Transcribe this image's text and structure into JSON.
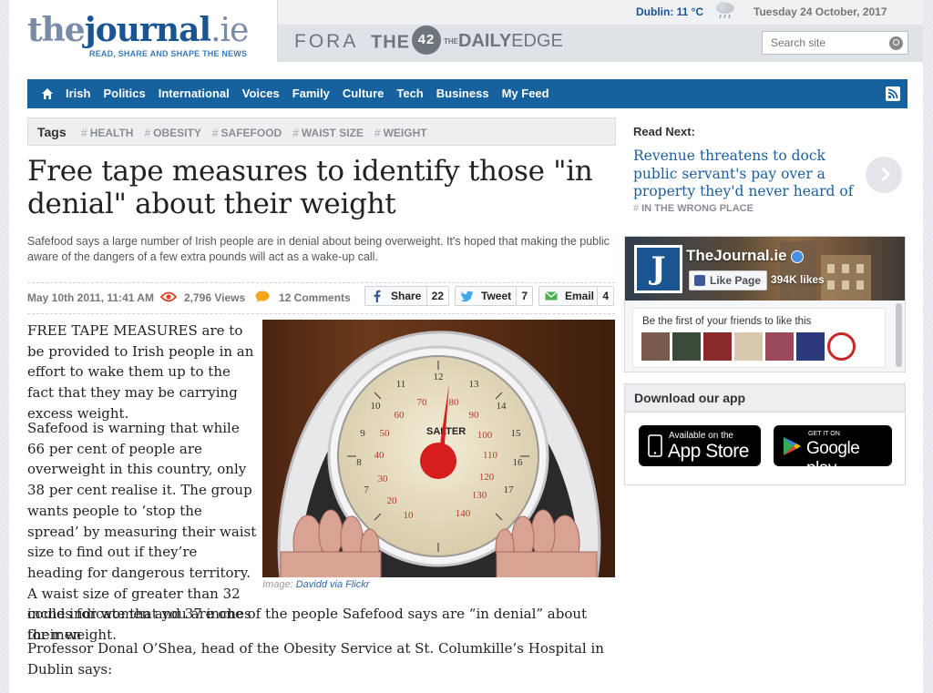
{
  "header": {
    "logo": {
      "the": "the",
      "journal": "journal",
      "ie": ".ie"
    },
    "tagline": "READ, SHARE AND SHAPE THE NEWS",
    "weather": "Dublin: 11 °C",
    "weather_icon": "rain-cloud-icon",
    "date": "Tuesday 24 October, 2017",
    "sister_sites": {
      "fora": "FORA",
      "the42_prefix": "THE",
      "the42_num": "42",
      "daily": "DAILY",
      "edge": "EDGE",
      "dailyedge_prefix": "THE"
    },
    "search_placeholder": "Search site"
  },
  "nav": {
    "items": [
      "Irish",
      "Politics",
      "International",
      "Voices",
      "Family",
      "Culture",
      "Tech",
      "Business",
      "My Feed"
    ]
  },
  "tags": {
    "label": "Tags",
    "items": [
      "HEALTH",
      "OBESITY",
      "SAFEFOOD",
      "WAIST SIZE",
      "WEIGHT"
    ]
  },
  "article": {
    "title": "Free tape measures to identify those \"in denial\" about their weight",
    "standfirst": "Safefood says a large number of Irish people are in denial about being overweight. It's hoped that making the public aware of the dangers of a few extra pounds will act as a wake-up call.",
    "meta": {
      "date": "May 10th 2011, 11:41 AM",
      "views": "2,796 Views",
      "comments": "12 Comments"
    },
    "share": {
      "facebook_label": "Share",
      "facebook_count": "22",
      "tweet_label": "Tweet",
      "tweet_count": "7",
      "email_label": "Email",
      "email_count": "4"
    },
    "p1": "FREE TAPE MEASURES are to be provided to Irish people in an effort to wake them up to the fact that they may be carrying excess weight.",
    "p2_col": "Safefood is warning that while 66 per cent of people are overweight in this country, only 38 per cent realise it. The group wants people to ‘stop the spread’ by measuring their waist size to find out if they’re heading for dangerous territory. A waist size of greater than 32 inches for women and 37 inches for men",
    "p2_full": "could indicate that you are one of the people Safefood says are “in denial” about their weight.",
    "p3": "Professor Donal O’Shea, head of the Obesity Service at St. Columkille’s Hospital in Dublin says:",
    "image_caption_prefix": "Image:",
    "image_credit": "Davidd via Flickr",
    "scale_brand": "SALTER"
  },
  "sidebar": {
    "read_next_label": "Read Next:",
    "read_next_title": "Revenue threatens to dock public servant's pay over a property they'd never heard of",
    "read_next_tag": "IN THE WRONG PLACE",
    "facebook": {
      "page_name": "TheJournal.ie",
      "logo_letter": "J",
      "like_label": "Like Page",
      "likes": "394K likes",
      "friends_text": "Be the first of your friends to like this"
    },
    "app": {
      "heading": "Download our app",
      "apple_small": "Available on the",
      "apple_big": "App Store",
      "google_small": "GET IT ON",
      "google_big": "Google play"
    }
  }
}
